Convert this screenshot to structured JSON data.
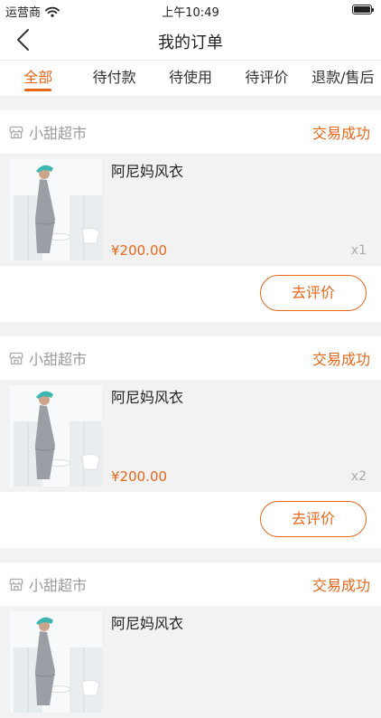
{
  "status_bar": {
    "carrier": "运营商",
    "time": "上午10:49"
  },
  "nav": {
    "title": "我的订单"
  },
  "tabs": [
    {
      "label": "全部",
      "active": true
    },
    {
      "label": "待付款",
      "active": false
    },
    {
      "label": "待使用",
      "active": false
    },
    {
      "label": "待评价",
      "active": false
    },
    {
      "label": "退款/售后",
      "active": false
    }
  ],
  "colors": {
    "accent": "#e8661a",
    "muted": "#999999",
    "background": "#f2f2f2"
  },
  "orders": [
    {
      "shop": "小甜超市",
      "status": "交易成功",
      "product": "阿尼妈风衣",
      "price": "¥200.00",
      "qty": "x1",
      "action": "去评价"
    },
    {
      "shop": "小甜超市",
      "status": "交易成功",
      "product": "阿尼妈风衣",
      "price": "¥200.00",
      "qty": "x2",
      "action": "去评价"
    },
    {
      "shop": "小甜超市",
      "status": "交易成功",
      "product": "阿尼妈风衣"
    }
  ]
}
